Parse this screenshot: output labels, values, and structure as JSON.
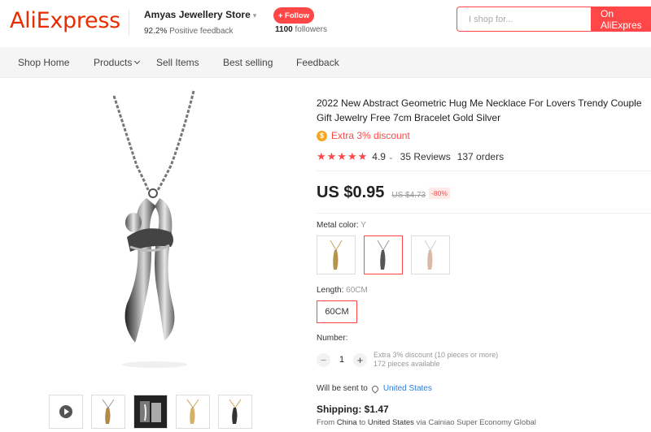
{
  "header": {
    "logo": "AliExpress",
    "store_name": "Amyas Jewellery Store",
    "feedback_percent": "92.2%",
    "feedback_text": "Positive feedback",
    "follow_label": "+ Follow",
    "followers_count": "1100",
    "followers_text": "followers",
    "search_placeholder": "I shop for...",
    "search_button": "On AliExpres"
  },
  "nav": {
    "items": [
      "Shop Home",
      "Products",
      "Sell Items",
      "Best selling",
      "Feedback"
    ]
  },
  "product": {
    "title": "2022 New Abstract Geometric Hug Me Necklace For Lovers Trendy Couple Gift Jewelry Free 7cm Bracelet Gold Silver",
    "extra_discount": "Extra 3% discount",
    "rating": "4.9",
    "reviews": "35 Reviews",
    "orders": "137 orders",
    "price": "US $0.95",
    "original_price": "US $4.73",
    "discount_percent": "-80%",
    "metal_color_label": "Metal color:",
    "metal_color_value": "Y",
    "length_label": "Length:",
    "length_value": "60CM",
    "length_option": "60CM",
    "number_label": "Number:",
    "quantity": "1",
    "qty_discount": "Extra 3% discount (10 pieces or more)",
    "pieces_available": "172 pieces available",
    "ship_to_label": "Will be sent to",
    "ship_to_country": "United States",
    "shipping": "Shipping: $1.47",
    "route_from_label": "From",
    "route_from": "China",
    "route_to_label": "to",
    "route_to": "United States",
    "route_via": "via Cainiao Super Economy Global"
  },
  "colors": {
    "brand": "#e62e04",
    "accent": "#ff4747",
    "link": "#2e7de1"
  }
}
